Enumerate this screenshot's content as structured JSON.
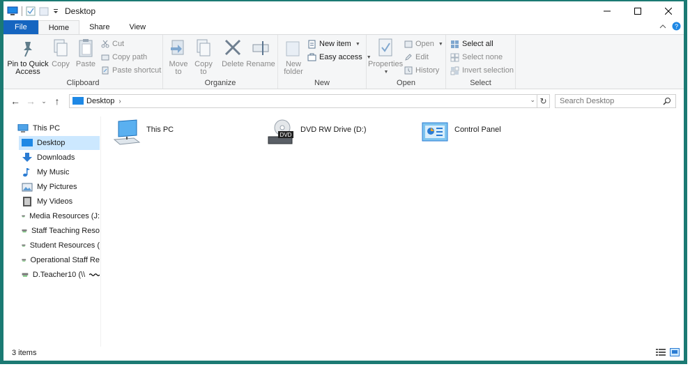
{
  "window": {
    "title": "Desktop"
  },
  "tabs": [
    {
      "label": "File"
    },
    {
      "label": "Home"
    },
    {
      "label": "Share"
    },
    {
      "label": "View"
    }
  ],
  "ribbon": {
    "clipboard": {
      "label": "Clipboard",
      "pin": "Pin to Quick\nAccess",
      "pin_l1": "Pin to Quick",
      "pin_l2": "Access",
      "copy": "Copy",
      "paste": "Paste",
      "cut": "Cut",
      "copy_path": "Copy path",
      "paste_shortcut": "Paste shortcut"
    },
    "organize": {
      "label": "Organize",
      "move_l1": "Move",
      "move_l2": "to",
      "copy_l1": "Copy",
      "copy_l2": "to",
      "delete": "Delete",
      "rename": "Rename"
    },
    "new": {
      "label": "New",
      "folder_l1": "New",
      "folder_l2": "folder",
      "new_item": "New item",
      "easy_access": "Easy access"
    },
    "open": {
      "label": "Open",
      "properties": "Properties",
      "open": "Open",
      "edit": "Edit",
      "history": "History"
    },
    "select": {
      "label": "Select",
      "all": "Select all",
      "none": "Select none",
      "invert": "Invert selection"
    }
  },
  "address": {
    "location": "Desktop",
    "search_placeholder": "Search Desktop"
  },
  "nav": {
    "items": [
      {
        "label": "This PC"
      },
      {
        "label": "Desktop"
      },
      {
        "label": "Downloads"
      },
      {
        "label": "My Music"
      },
      {
        "label": "My Pictures"
      },
      {
        "label": "My Videos"
      },
      {
        "label": "Media Resources (J:"
      },
      {
        "label": "Staff Teaching Reso"
      },
      {
        "label": "Student Resources ("
      },
      {
        "label": "Operational Staff Re"
      },
      {
        "label": "D.Teacher10 (\\\\"
      }
    ]
  },
  "content": {
    "items": [
      {
        "label": "This PC"
      },
      {
        "label": "DVD RW Drive (D:)"
      },
      {
        "label": "Control Panel"
      }
    ],
    "dvd_badge": "DVD"
  },
  "status": {
    "count": "3 items"
  },
  "colors": {
    "accent": "#1565c0",
    "frame": "#1b7a73",
    "selected": "#cce8ff"
  }
}
